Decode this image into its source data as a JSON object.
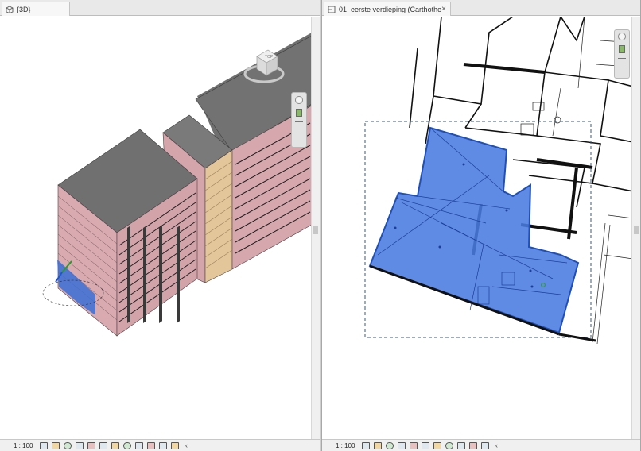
{
  "left_view": {
    "tab_label": "{3D}",
    "tab_icon": "3d-view-icon",
    "viewcube_face": "TOP",
    "scale": "1 : 100",
    "colors": {
      "roof": "#777777",
      "facade": "#d8a8ad",
      "window_band": "#f0d8a0",
      "selection": "#3a6fd6"
    }
  },
  "right_view": {
    "tab_label": "01_eerste verdieping (Carthothe...",
    "tab_icon": "floor-plan-icon",
    "tab_close": "×",
    "scale": "1 : 100",
    "colors": {
      "selection_fill": "#4a7be0",
      "selection_border": "#1f4fb8",
      "crop_region": "#3c5a73"
    }
  },
  "statusbar_icons": [
    "detail-level-icon",
    "visual-style-icon",
    "sun-path-icon",
    "shadows-icon",
    "render-icon",
    "crop-icon",
    "crop-visibility-icon",
    "temporary-hide-icon",
    "reveal-hidden-icon",
    "analytical-model-icon",
    "highlight-displacement-icon",
    "constraints-icon"
  ]
}
